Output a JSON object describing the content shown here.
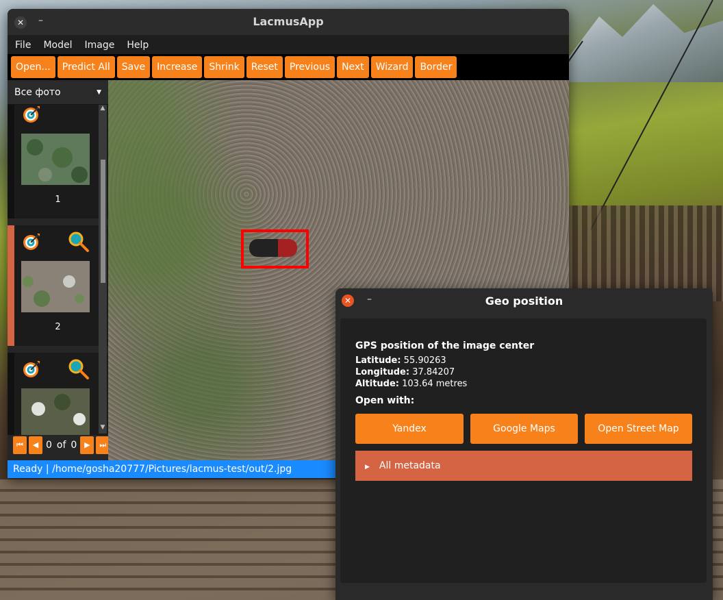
{
  "main_window": {
    "title": "LacmusApp",
    "close_glyph": "✕",
    "minimize_glyph": "–"
  },
  "menu": [
    "File",
    "Model",
    "Image",
    "Help"
  ],
  "toolbar": [
    "Open...",
    "Predict All",
    "Save",
    "Increase",
    "Shrink",
    "Reset",
    "Previous",
    "Next",
    "Wizard",
    "Border"
  ],
  "sidebar": {
    "filter_value": "Все фото",
    "thumbnails": [
      {
        "label": "1",
        "has_detection": false
      },
      {
        "label": "2",
        "has_detection": true
      },
      {
        "label": "",
        "has_detection": true
      }
    ],
    "pager": {
      "current": "0",
      "of_label": "of",
      "total": "0"
    }
  },
  "status": {
    "text": "Ready | /home/gosha20777/Pictures/lacmus-test/out/2.jpg"
  },
  "geo_window": {
    "title": "Geo position",
    "close_glyph": "✕",
    "minimize_glyph": "–",
    "heading": "GPS position of the image center",
    "latitude_label": "Latitude:",
    "latitude_value": "55.90263",
    "longitude_label": "Longitude:",
    "longitude_value": "37.84207",
    "altitude_label": "Altitude:",
    "altitude_value": "103.64 metres",
    "open_with_label": "Open with:",
    "buttons": [
      "Yandex",
      "Google Maps",
      "Open Street Map"
    ],
    "metadata_label": "All metadata"
  },
  "colors": {
    "accent_orange": "#f7821b",
    "selected_marker": "#d46444",
    "status_blue": "#1a8bff",
    "bbox_red": "#ff0000"
  },
  "icons": [
    "target-icon",
    "magnifier-icon",
    "dropdown-arrow-icon",
    "first-page-icon",
    "prev-page-icon",
    "next-page-icon",
    "last-page-icon",
    "expand-arrow-icon"
  ]
}
